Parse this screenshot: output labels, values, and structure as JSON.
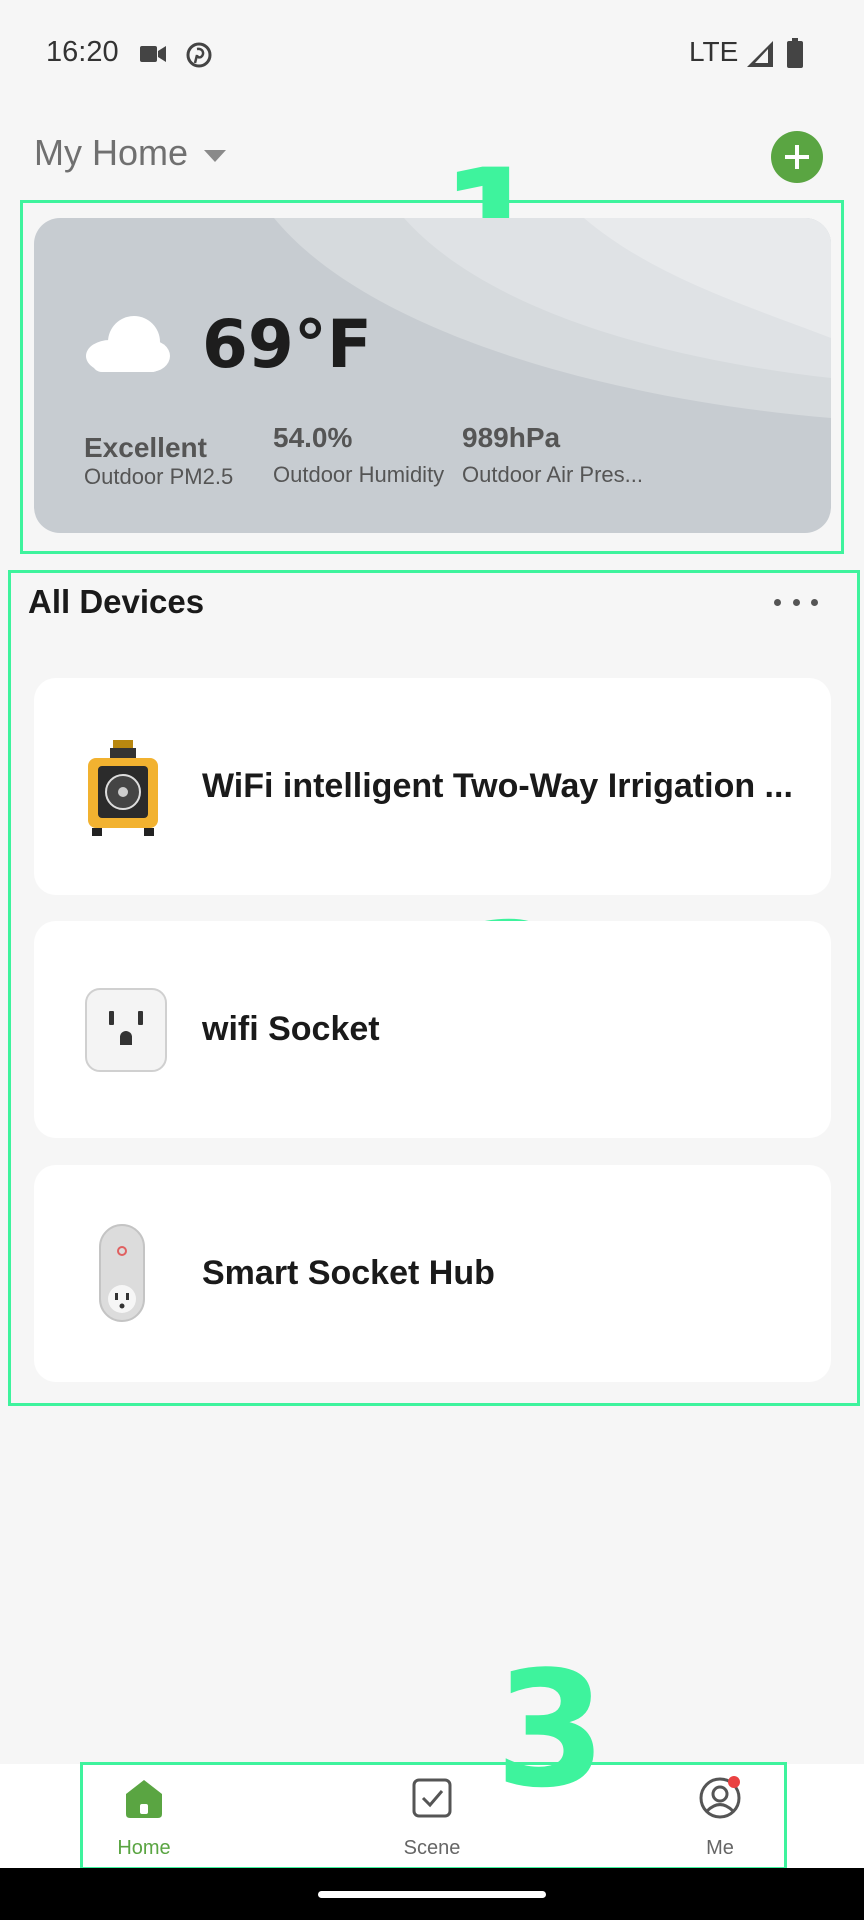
{
  "status_bar": {
    "time": "16:20",
    "network": "LTE",
    "icons": [
      "video-icon",
      "pinterest-icon",
      "signal-icon",
      "battery-icon"
    ]
  },
  "header": {
    "home_name": "My Home",
    "add_icon": "plus-icon"
  },
  "weather": {
    "temperature": "69°F",
    "icon": "cloud-icon",
    "pm25_value": "Excellent",
    "pm25_label": "Outdoor PM2.5",
    "humidity_value": "54.0%",
    "humidity_label": "Outdoor Humidity",
    "pressure_value": "989hPa",
    "pressure_label": "Outdoor Air Pres..."
  },
  "devices": {
    "title": "All Devices",
    "more_icon": "more-dots-icon",
    "items": [
      {
        "name": "WiFi intelligent Two-Way Irrigation ...",
        "icon": "irrigation-timer-icon"
      },
      {
        "name": "wifi Socket",
        "icon": "wall-socket-icon"
      },
      {
        "name": "Smart Socket Hub",
        "icon": "plug-hub-icon"
      }
    ]
  },
  "bottom_nav": {
    "items": [
      {
        "label": "Home",
        "icon": "home-icon",
        "active": true
      },
      {
        "label": "Scene",
        "icon": "checkbox-icon",
        "active": false
      },
      {
        "label": "Me",
        "icon": "user-icon",
        "active": false,
        "badge": true
      }
    ],
    "active_color": "#5aa542",
    "inactive_color": "#666666"
  },
  "annotations": {
    "frame_1_label": "1",
    "frame_2_label": "2",
    "frame_3_label": "3",
    "color": "#3ef39d"
  }
}
